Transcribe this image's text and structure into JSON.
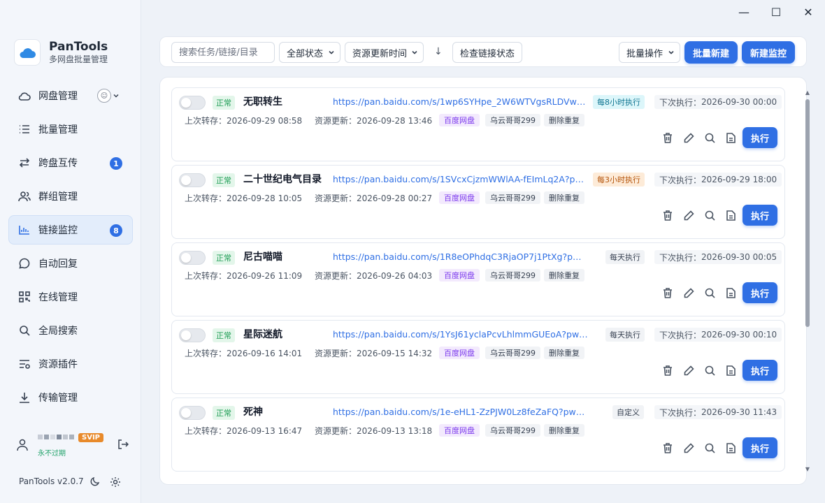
{
  "app": {
    "name": "PanTools",
    "subtitle": "多网盘批量管理",
    "version": "PanTools v2.0.7"
  },
  "window_controls": {
    "minimize": "—",
    "maximize": "☐",
    "close": "✕"
  },
  "sidebar": {
    "items": [
      {
        "label": "网盘管理",
        "icon": "cloud-icon"
      },
      {
        "label": "批量管理",
        "icon": "list-icon"
      },
      {
        "label": "跨盘互传",
        "icon": "transfer-icon",
        "badge": "1"
      },
      {
        "label": "群组管理",
        "icon": "group-icon"
      },
      {
        "label": "链接监控",
        "icon": "chart-icon",
        "badge": "8",
        "active": true
      },
      {
        "label": "自动回复",
        "icon": "chat-icon"
      },
      {
        "label": "在线管理",
        "icon": "grid-icon"
      },
      {
        "label": "全局搜索",
        "icon": "search-icon"
      },
      {
        "label": "资源插件",
        "icon": "plugin-icon"
      },
      {
        "label": "传输管理",
        "icon": "download-icon"
      }
    ],
    "user": {
      "badge": "SVIP",
      "expiry": "永不过期"
    }
  },
  "toolbar": {
    "search_placeholder": "搜索任务/链接/目录",
    "status_filter": "全部状态",
    "sort_field": "资源更新时间",
    "sort_dir_icon": "↓",
    "check_links": "检查链接状态",
    "batch_ops": "批量操作",
    "batch_new": "批量新建",
    "new_monitor": "新建监控"
  },
  "labels": {
    "last_transfer": "上次转存：",
    "resource_update": "资源更新：",
    "next_run": "下次执行：",
    "run": "执行"
  },
  "tasks": [
    {
      "status": "正常",
      "title": "无职转生",
      "link": "https://pan.baidu.com/s/1wp6SYHpe_2W6WTVgsRLDVw?pw...",
      "schedule": "每8小时执行",
      "schedule_style": "cyan",
      "next_run": "2026-09-30 00:00",
      "last_transfer": "2026-09-29 08:58",
      "resource_update": "2026-09-28 13:46",
      "tags": [
        "百度网盘",
        "乌云哥哥299",
        "删除重复"
      ]
    },
    {
      "status": "正常",
      "title": "二十世纪电气目录",
      "link": "https://pan.baidu.com/s/1SVcxCjzmWWlAA-fEImLq2A?pwd=j...",
      "schedule": "每3小时执行",
      "schedule_style": "orange",
      "next_run": "2026-09-29 18:00",
      "last_transfer": "2026-09-28 10:05",
      "resource_update": "2026-09-28 00:27",
      "tags": [
        "百度网盘",
        "乌云哥哥299",
        "删除重复"
      ]
    },
    {
      "status": "正常",
      "title": "尼古喵喵",
      "link": "https://pan.baidu.com/s/1R8eOPhdqC3RjaOP7j1PtXg?pwd=nw9q",
      "schedule": "每天执行",
      "schedule_style": "gray",
      "next_run": "2026-09-30 00:05",
      "last_transfer": "2026-09-26 11:09",
      "resource_update": "2026-09-26 04:03",
      "tags": [
        "百度网盘",
        "乌云哥哥299",
        "删除重复"
      ]
    },
    {
      "status": "正常",
      "title": "星际迷航",
      "link": "https://pan.baidu.com/s/1YsJ61yclaPcvLhlmmGUEoA?pwd=eyg9",
      "schedule": "每天执行",
      "schedule_style": "gray",
      "next_run": "2026-09-30 00:10",
      "last_transfer": "2026-09-16 14:01",
      "resource_update": "2026-09-15 14:32",
      "tags": [
        "百度网盘",
        "乌云哥哥299",
        "删除重复"
      ]
    },
    {
      "status": "正常",
      "title": "死神",
      "link": "https://pan.baidu.com/s/1e-eHL1-ZzPJW0Lz8feZaFQ?pwd=nf97",
      "schedule": "自定义",
      "schedule_style": "gray",
      "next_run": "2026-09-30 11:43",
      "last_transfer": "2026-09-13 16:47",
      "resource_update": "2026-09-13 13:18",
      "tags": [
        "百度网盘",
        "乌云哥哥299",
        "删除重复"
      ]
    }
  ]
}
